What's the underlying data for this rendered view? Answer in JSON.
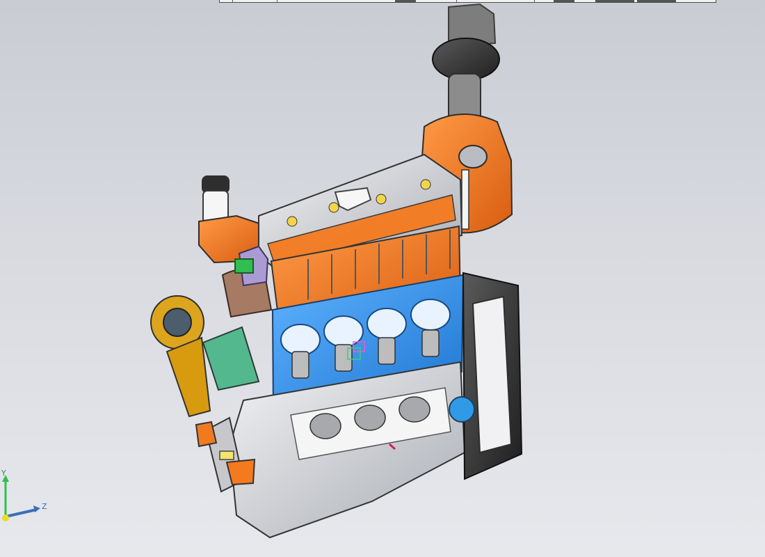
{
  "viewport": {
    "model": "engine-section-view",
    "background_top": "#c9ccd3",
    "background_bottom": "#e7e8ec"
  },
  "colors": {
    "orange": "#f47a1f",
    "blue": "#2f8fe8",
    "grey": "#c9cbd0",
    "dark": "#2a2a2a",
    "yellow": "#e8c52a",
    "green": "#2fbf52",
    "purple": "#9b8ad1"
  },
  "triad": {
    "y_label": "Y",
    "z_label": "Z"
  }
}
